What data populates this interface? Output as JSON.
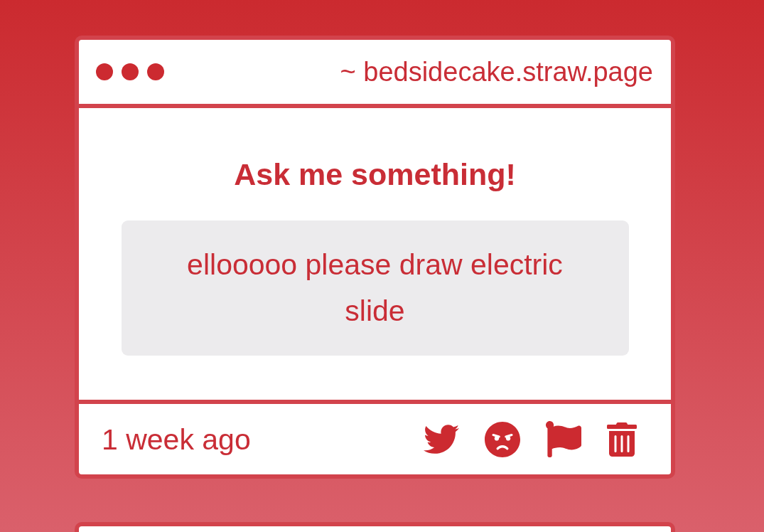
{
  "header": {
    "address": "~ bedsidecake.straw.page"
  },
  "question": {
    "title": "Ask me something!",
    "text": "ellooooo please draw electric slide"
  },
  "footer": {
    "time": "1 week ago",
    "actions": [
      {
        "kind": "share"
      },
      {
        "kind": "react"
      },
      {
        "kind": "report"
      },
      {
        "kind": "delete"
      }
    ]
  }
}
